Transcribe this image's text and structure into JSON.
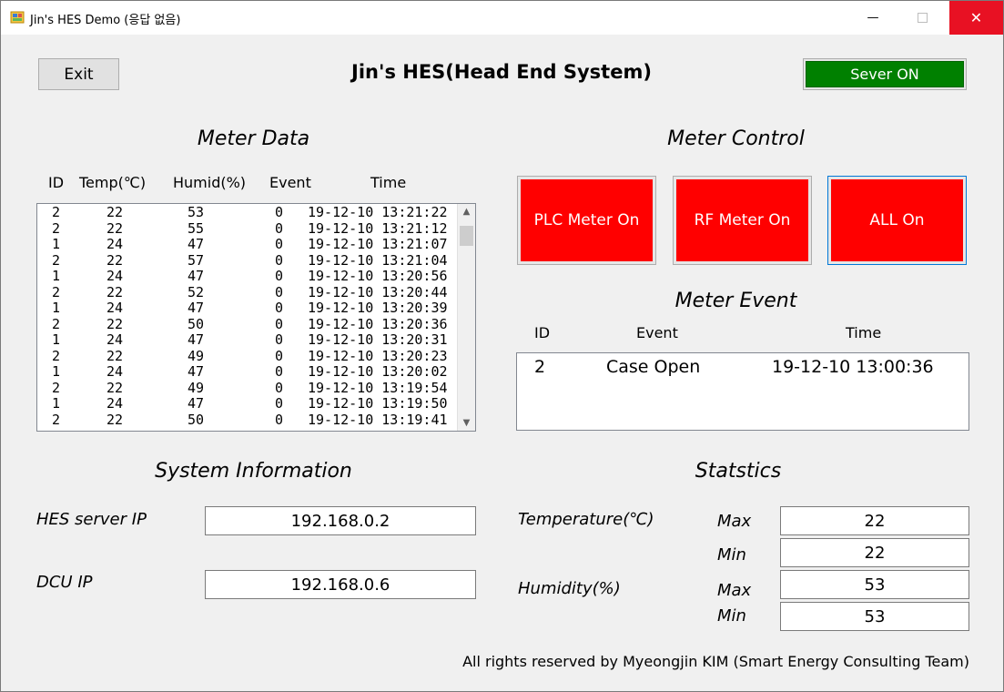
{
  "window": {
    "title": "Jin's HES Demo (응답 없음)",
    "minimize_glyph": "—",
    "close_glyph": "✕"
  },
  "header": {
    "exit_label": "Exit",
    "main_title": "Jin's HES(Head End System)",
    "server_status": "Sever ON",
    "server_status_color": "#008000"
  },
  "meter_data": {
    "title": "Meter Data",
    "columns": [
      "ID",
      "Temp(℃)",
      "Humid(%)",
      "Event",
      "Time"
    ],
    "rows": [
      [
        "2",
        "22",
        "53",
        "0",
        "19-12-10 13:21:22"
      ],
      [
        "2",
        "22",
        "55",
        "0",
        "19-12-10 13:21:12"
      ],
      [
        "1",
        "24",
        "47",
        "0",
        "19-12-10 13:21:07"
      ],
      [
        "2",
        "22",
        "57",
        "0",
        "19-12-10 13:21:04"
      ],
      [
        "1",
        "24",
        "47",
        "0",
        "19-12-10 13:20:56"
      ],
      [
        "2",
        "22",
        "52",
        "0",
        "19-12-10 13:20:44"
      ],
      [
        "1",
        "24",
        "47",
        "0",
        "19-12-10 13:20:39"
      ],
      [
        "2",
        "22",
        "50",
        "0",
        "19-12-10 13:20:36"
      ],
      [
        "1",
        "24",
        "47",
        "0",
        "19-12-10 13:20:31"
      ],
      [
        "2",
        "22",
        "49",
        "0",
        "19-12-10 13:20:23"
      ],
      [
        "1",
        "24",
        "47",
        "0",
        "19-12-10 13:20:02"
      ],
      [
        "2",
        "22",
        "49",
        "0",
        "19-12-10 13:19:54"
      ],
      [
        "1",
        "24",
        "47",
        "0",
        "19-12-10 13:19:50"
      ],
      [
        "2",
        "22",
        "50",
        "0",
        "19-12-10 13:19:41"
      ]
    ]
  },
  "meter_control": {
    "title": "Meter Control",
    "buttons": [
      "PLC Meter On",
      "RF Meter On",
      "ALL On"
    ],
    "button_color": "#ff0000"
  },
  "meter_event": {
    "title": "Meter Event",
    "columns": [
      "ID",
      "Event",
      "Time"
    ],
    "rows": [
      [
        "2",
        "Case Open",
        "19-12-10 13:00:36"
      ]
    ]
  },
  "system_info": {
    "title": "System Information",
    "hes_label": "HES server IP",
    "hes_ip": "192.168.0.2",
    "dcu_label": "DCU IP",
    "dcu_ip": "192.168.0.6"
  },
  "statistics": {
    "title": "Statstics",
    "temp_label": "Temperature(℃)",
    "humid_label": "Humidity(%)",
    "max_label": "Max",
    "min_label": "Min",
    "temp_max": "22",
    "temp_min": "22",
    "humid_max": "53",
    "humid_min": "53"
  },
  "footer": "All rights reserved by Myeongjin KIM (Smart Energy Consulting Team)"
}
